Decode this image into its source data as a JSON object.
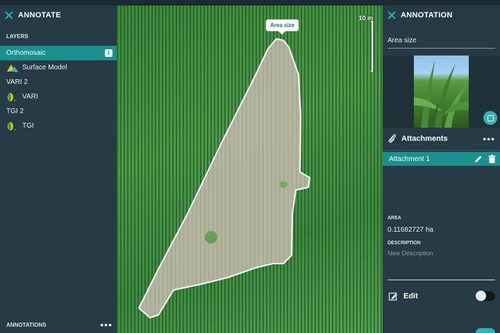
{
  "left_panel": {
    "title": "ANNOTATE",
    "layers_label": "LAYERS",
    "layers": [
      {
        "label": "Orthomosaic",
        "active": true,
        "badge": "1"
      },
      {
        "label": "Surface Model",
        "icon": "terrain-icon"
      },
      {
        "label": "VARI 2"
      },
      {
        "label": "VARI",
        "icon": "index-icon"
      },
      {
        "label": "TGI 2"
      },
      {
        "label": "TGI",
        "icon": "index-icon"
      }
    ],
    "annotations_label": "ANNOTATIONS",
    "more_glyph": "•••"
  },
  "map": {
    "tooltip": "Area size",
    "scale_label": "10 m"
  },
  "right_panel": {
    "title": "ANNOTATION",
    "name_value": "Area size",
    "attachments_title": "Attachments",
    "more_glyph": "•••",
    "attachment_item": "Attachment 1",
    "area_label": "AREA",
    "area_value": "0.11682727 ha",
    "description_label": "DESCRIPTION",
    "description_placeholder": "New Description",
    "edit_label": "Edit",
    "edit_enabled": false
  },
  "colors": {
    "accent": "#1c8f8f",
    "teal_icon": "#2fb3b8",
    "panel_bg": "#263b46"
  }
}
